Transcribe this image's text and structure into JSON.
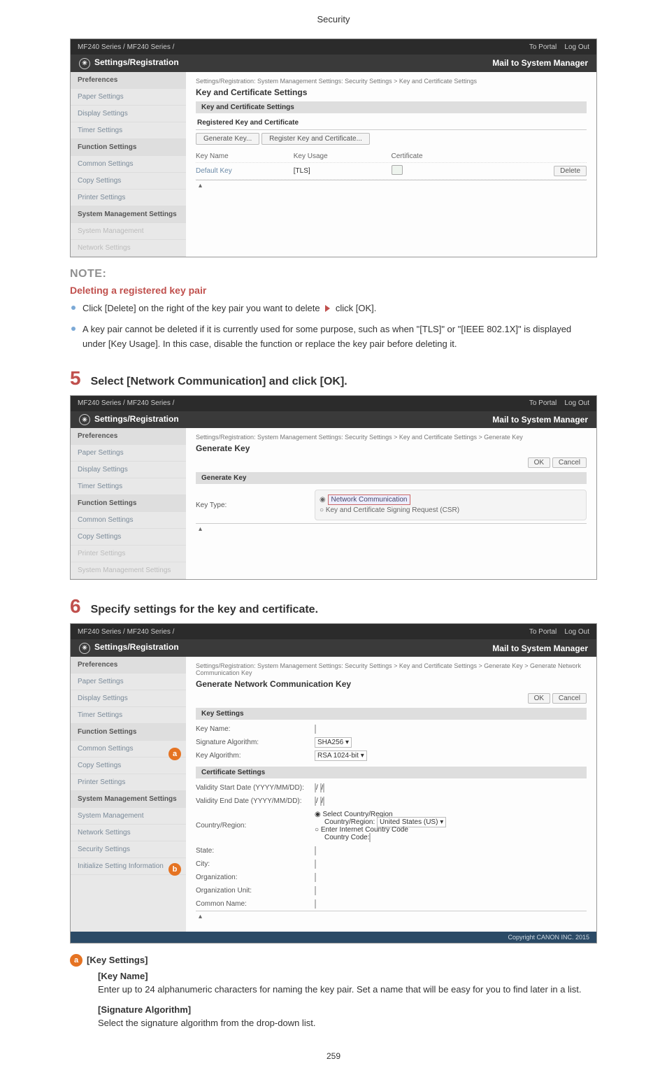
{
  "doc": {
    "header": "Security",
    "page_number": "259"
  },
  "topbar": {
    "series": "MF240 Series / MF240 Series /",
    "to_portal": "To Portal",
    "log_out": "Log Out"
  },
  "settings_header": {
    "title": "Settings/Registration",
    "mail_link": "Mail to System Manager"
  },
  "sidebar": {
    "preferences": "Preferences",
    "items_a": [
      "Paper Settings",
      "Display Settings",
      "Timer Settings"
    ],
    "function": "Function Settings",
    "items_b": [
      "Common Settings",
      "Copy Settings",
      "Printer Settings"
    ],
    "sysmgmt": "System Management Settings",
    "items_c": [
      "System Management",
      "Network Settings"
    ]
  },
  "ss1": {
    "breadcrumb": "Settings/Registration: System Management Settings: Security Settings > Key and Certificate Settings",
    "title": "Key and Certificate Settings",
    "subhead": "Key and Certificate Settings",
    "section": "Registered Key and Certificate",
    "btn_generate": "Generate Key...",
    "btn_register": "Register Key and Certificate...",
    "col_name": "Key Name",
    "col_usage": "Key Usage",
    "col_cert": "Certificate",
    "row_name": "Default Key",
    "row_usage": "[TLS]",
    "btn_delete": "Delete"
  },
  "note": {
    "heading": "NOTE:",
    "sub": "Deleting a registered key pair",
    "bullet1_a": "Click [Delete] on the right of the key pair you want to delete ",
    "bullet1_b": " click [OK].",
    "bullet2": "A key pair cannot be deleted if it is currently used for some purpose, such as when \"[TLS]\" or \"[IEEE 802.1X]\" is displayed under [Key Usage]. In this case, disable the function or replace the key pair before deleting it."
  },
  "step5": {
    "num": "5",
    "text": "Select [Network Communication] and click [OK]."
  },
  "ss2": {
    "breadcrumb": "Settings/Registration: System Management Settings: Security Settings > Key and Certificate Settings > Generate Key",
    "title": "Generate Key",
    "btn_ok": "OK",
    "btn_cancel": "Cancel",
    "subhead": "Generate Key",
    "label_keytype": "Key Type:",
    "opt_net": "Network Communication",
    "opt_csr": "Key and Certificate Signing Request (CSR)"
  },
  "step6": {
    "num": "6",
    "text": "Specify settings for the key and certificate."
  },
  "ss3": {
    "breadcrumb": "Settings/Registration: System Management Settings: Security Settings > Key and Certificate Settings > Generate Key > Generate Network Communication Key",
    "title": "Generate Network Communication Key",
    "btn_ok": "OK",
    "btn_cancel": "Cancel",
    "keysettings": "Key Settings",
    "key_name": "Key Name:",
    "sig_alg": "Signature Algorithm:",
    "sig_alg_val": "SHA256",
    "key_alg": "Key Algorithm:",
    "key_alg_val": "RSA 1024-bit",
    "certsettings": "Certificate Settings",
    "val_start": "Validity Start Date (YYYY/MM/DD):",
    "val_end": "Validity End Date (YYYY/MM/DD):",
    "country": "Country/Region:",
    "country_opt1": "Select Country/Region",
    "country_sel": "Country/Region:",
    "country_sel_val": "United States (US)",
    "country_opt2": "Enter Internet Country Code",
    "country_code": "Country Code:",
    "state": "State:",
    "city": "City:",
    "org": "Organization:",
    "orgunit": "Organization Unit:",
    "common": "Common Name:",
    "footer": "Copyright CANON INC. 2015"
  },
  "keysettings_doc": {
    "balloon": "a",
    "title": "[Key Settings]",
    "kn_title": "[Key Name]",
    "kn_desc": "Enter up to 24 alphanumeric characters for naming the key pair. Set a name that will be easy for you to find later in a list.",
    "sa_title": "[Signature Algorithm]",
    "sa_desc": "Select the signature algorithm from the drop-down list."
  },
  "sidebar_ext": {
    "sys_mgmt": "System Management",
    "net": "Network Settings",
    "sec": "Security Settings",
    "init": "Initialize Setting Information"
  }
}
